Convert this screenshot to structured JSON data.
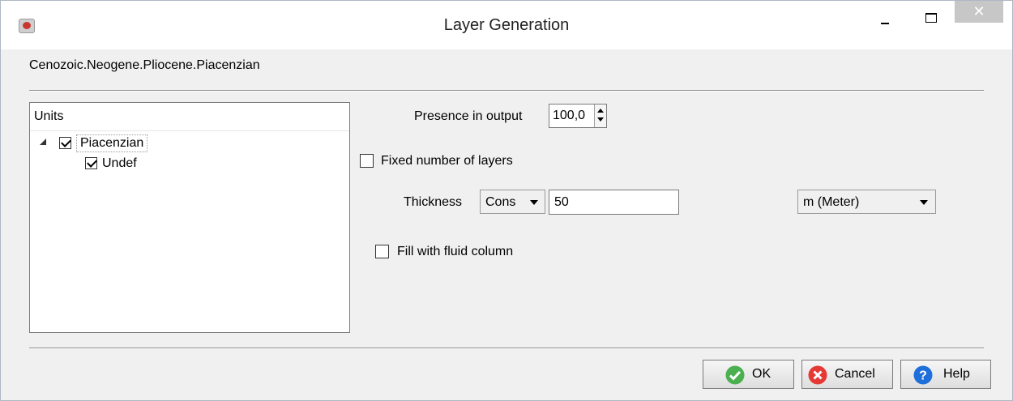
{
  "window": {
    "title": "Layer Generation",
    "close_glyph": "✕"
  },
  "breadcrumb": "Cenozoic.Neogene.Pliocene.Piacenzian",
  "units": {
    "header": "Units",
    "items": [
      {
        "label": "Piacenzian",
        "checked": true,
        "expanded": true
      },
      {
        "label": "Undef",
        "checked": true
      }
    ]
  },
  "form": {
    "presence_label": "Presence in output",
    "presence_value": "100,0",
    "fixed_layers_label": "Fixed number of layers",
    "fixed_layers_checked": false,
    "thickness_label": "Thickness",
    "thickness_mode": "Cons",
    "thickness_value": "50",
    "unit_value": "m (Meter)",
    "fluid_label": "Fill with fluid column",
    "fluid_checked": false
  },
  "buttons": {
    "ok": "OK",
    "cancel": "Cancel",
    "help": "Help"
  },
  "colors": {
    "ok_icon": "#4caf50",
    "cancel_icon": "#e53935",
    "help_icon": "#1e6fd9"
  }
}
